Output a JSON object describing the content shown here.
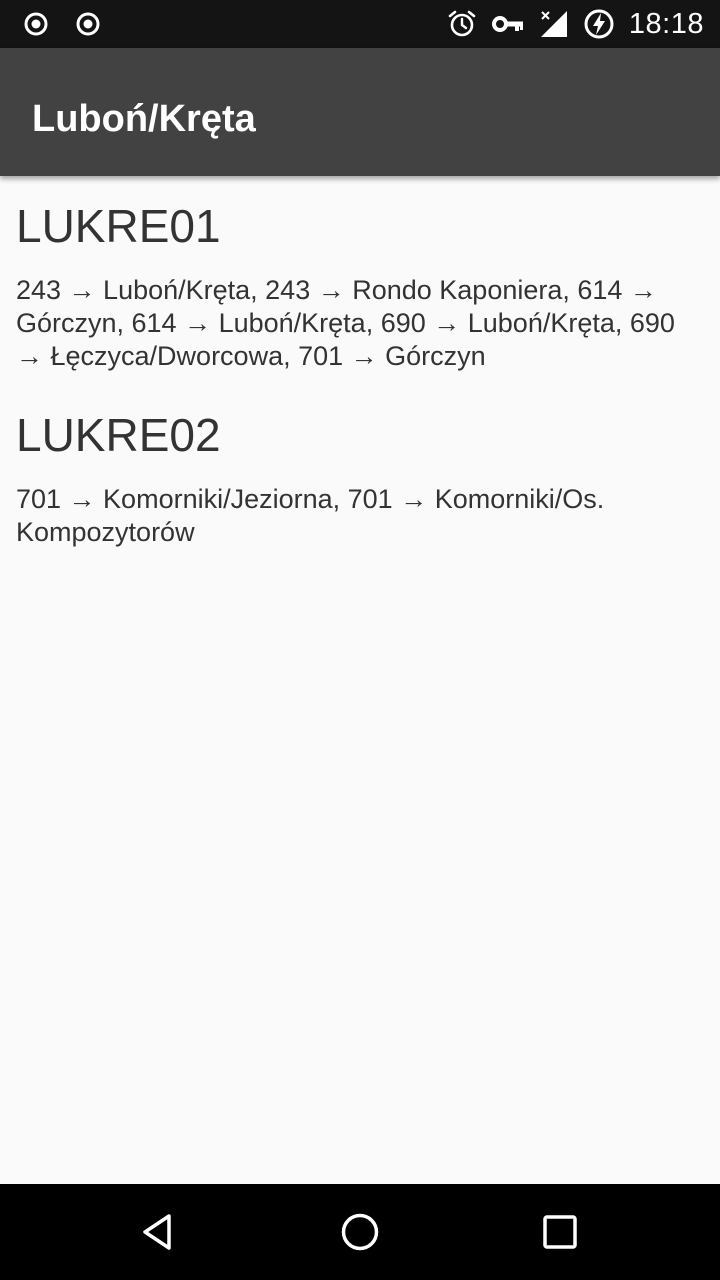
{
  "status_bar": {
    "time": "18:18",
    "icons": [
      "record-icon",
      "record-icon",
      "alarm-icon",
      "vpn-key-icon",
      "signal-no-data-icon",
      "battery-charging-icon"
    ]
  },
  "app_bar": {
    "title": "Luboń/Kręta"
  },
  "stops": [
    {
      "code": "LUKRE01",
      "routes": "243 → Luboń/Kręta, 243 → Rondo Kaponiera, 614 → Górczyn, 614 → Luboń/Kręta, 690 → Luboń/Kręta, 690 → Łęczyca/Dworcowa, 701 → Górczyn"
    },
    {
      "code": "LUKRE02",
      "routes": "701 → Komorniki/Jeziorna, 701 → Komorniki/Os. Kompozytorów"
    }
  ],
  "nav_bar": {
    "buttons": [
      "back-icon",
      "home-icon",
      "recents-icon"
    ]
  }
}
